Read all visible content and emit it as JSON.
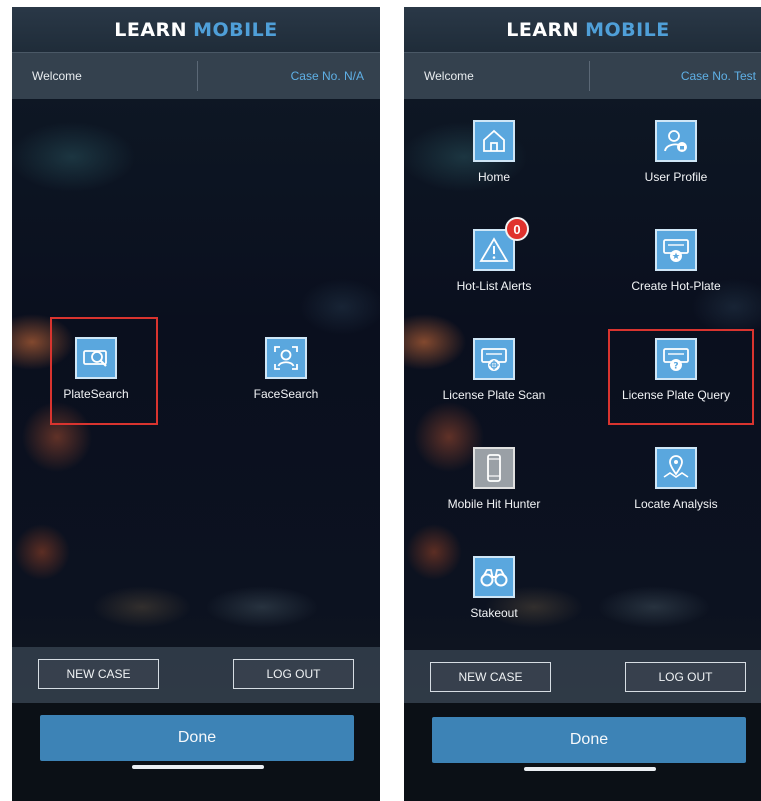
{
  "left_screen": {
    "app_title_part1": "LEARN",
    "app_title_part2": "MOBILE",
    "welcome": "Welcome",
    "case_no": "Case No. N/A",
    "tiles": [
      {
        "label": "PlateSearch",
        "icon": "plate-search-icon"
      },
      {
        "label": "FaceSearch",
        "icon": "face-search-icon"
      }
    ],
    "new_case": "NEW CASE",
    "log_out": "LOG OUT",
    "done": "Done"
  },
  "right_screen": {
    "app_title_part1": "LEARN",
    "app_title_part2": "MOBILE",
    "welcome": "Welcome",
    "case_no": "Case No. Test",
    "tiles": [
      {
        "label": "Home",
        "icon": "home-icon"
      },
      {
        "label": "User Profile",
        "icon": "user-profile-icon"
      },
      {
        "label": "Hot-List Alerts",
        "icon": "alert-icon",
        "badge": "0"
      },
      {
        "label": "Create Hot-Plate",
        "icon": "create-hot-plate-icon"
      },
      {
        "label": "License Plate Scan",
        "icon": "plate-scan-icon"
      },
      {
        "label": "License Plate Query",
        "icon": "plate-query-icon"
      },
      {
        "label": "Mobile Hit Hunter",
        "icon": "mobile-phone-icon"
      },
      {
        "label": "Locate Analysis",
        "icon": "map-pin-icon"
      },
      {
        "label": "Stakeout",
        "icon": "binoculars-icon"
      }
    ],
    "new_case": "NEW CASE",
    "log_out": "LOG OUT",
    "done": "Done"
  },
  "colors": {
    "accent": "#4f9fd8",
    "tile": "#5aa7de",
    "highlight": "#d9342f",
    "done_button": "#3d83b6",
    "badge": "#e0322d"
  }
}
